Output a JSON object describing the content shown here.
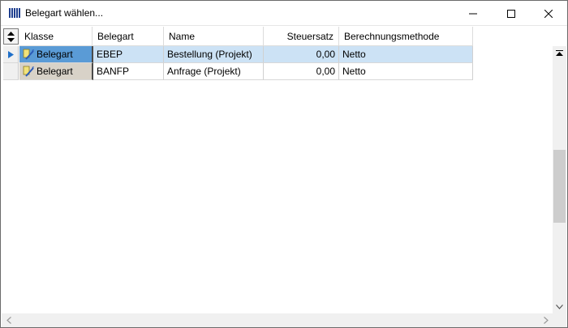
{
  "window": {
    "title": "Belegart wählen...",
    "app_icon": "library-icon",
    "buttons": [
      "minimize",
      "maximize",
      "close"
    ]
  },
  "grid": {
    "columns": [
      "Klasse",
      "Belegart",
      "Name",
      "Steuersatz",
      "Berechnungsmethode"
    ],
    "rows": [
      {
        "klasse": "Belegart",
        "belegart": "EBEP",
        "name": "Bestellung (Projekt)",
        "steuersatz": "0,00",
        "methode": "Netto",
        "selected": true
      },
      {
        "klasse": "Belegart",
        "belegart": "BANFP",
        "name": "Anfrage (Projekt)",
        "steuersatz": "0,00",
        "methode": "Netto",
        "selected": false
      }
    ],
    "colors": {
      "selected_row": "#cce2f5",
      "selected_klasse": "#5a9bd6",
      "klasse_cell": "#d8d2c8"
    }
  }
}
